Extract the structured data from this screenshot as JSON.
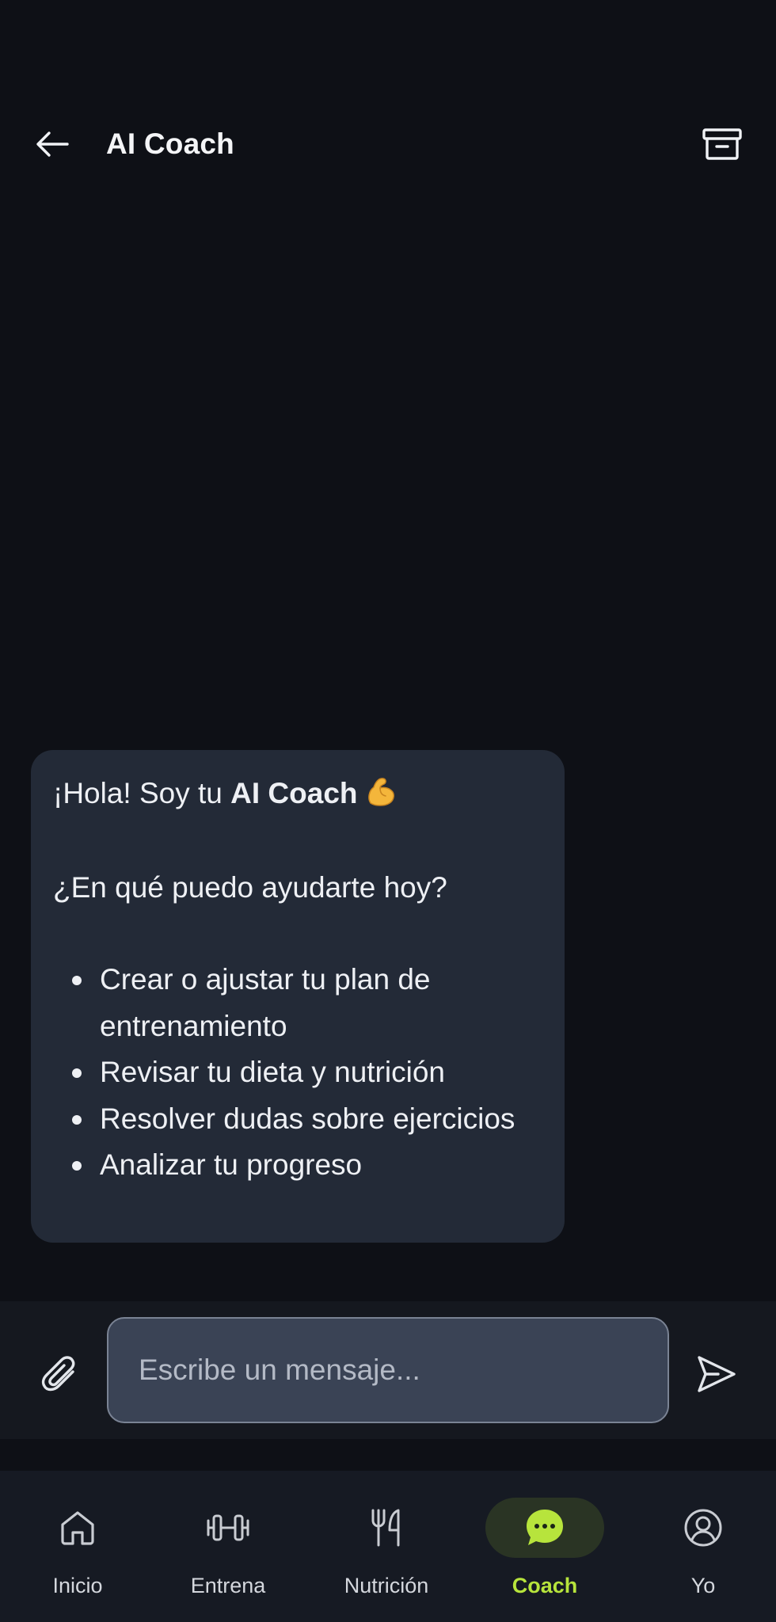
{
  "header": {
    "title": "AI Coach",
    "back_icon": "arrow-left-icon",
    "archive_icon": "archive-icon"
  },
  "chat": {
    "message": {
      "greeting_prefix": "¡Hola! Soy tu ",
      "greeting_bold": "AI Coach",
      "greeting_emoji": "flexed-biceps-emoji",
      "question": "¿En qué puedo ayudarte hoy?",
      "bullets": [
        "Crear o ajustar tu plan de entrenamiento",
        "Revisar tu dieta y nutrición",
        "Resolver dudas sobre ejercicios",
        "Analizar tu progreso"
      ]
    }
  },
  "composer": {
    "placeholder": "Escribe un mensaje...",
    "value": "",
    "attach_icon": "paperclip-icon",
    "send_icon": "send-icon"
  },
  "nav": {
    "items": [
      {
        "label": "Inicio",
        "icon": "home-icon",
        "active": false
      },
      {
        "label": "Entrena",
        "icon": "dumbbell-icon",
        "active": false
      },
      {
        "label": "Nutrición",
        "icon": "fork-knife-icon",
        "active": false
      },
      {
        "label": "Coach",
        "icon": "chat-bubble-icon",
        "active": true
      },
      {
        "label": "Yo",
        "icon": "user-icon",
        "active": false
      }
    ]
  },
  "colors": {
    "background": "#0e1016",
    "bubble": "#232a37",
    "accent": "#b7e43c",
    "nav_background": "#161a23"
  }
}
